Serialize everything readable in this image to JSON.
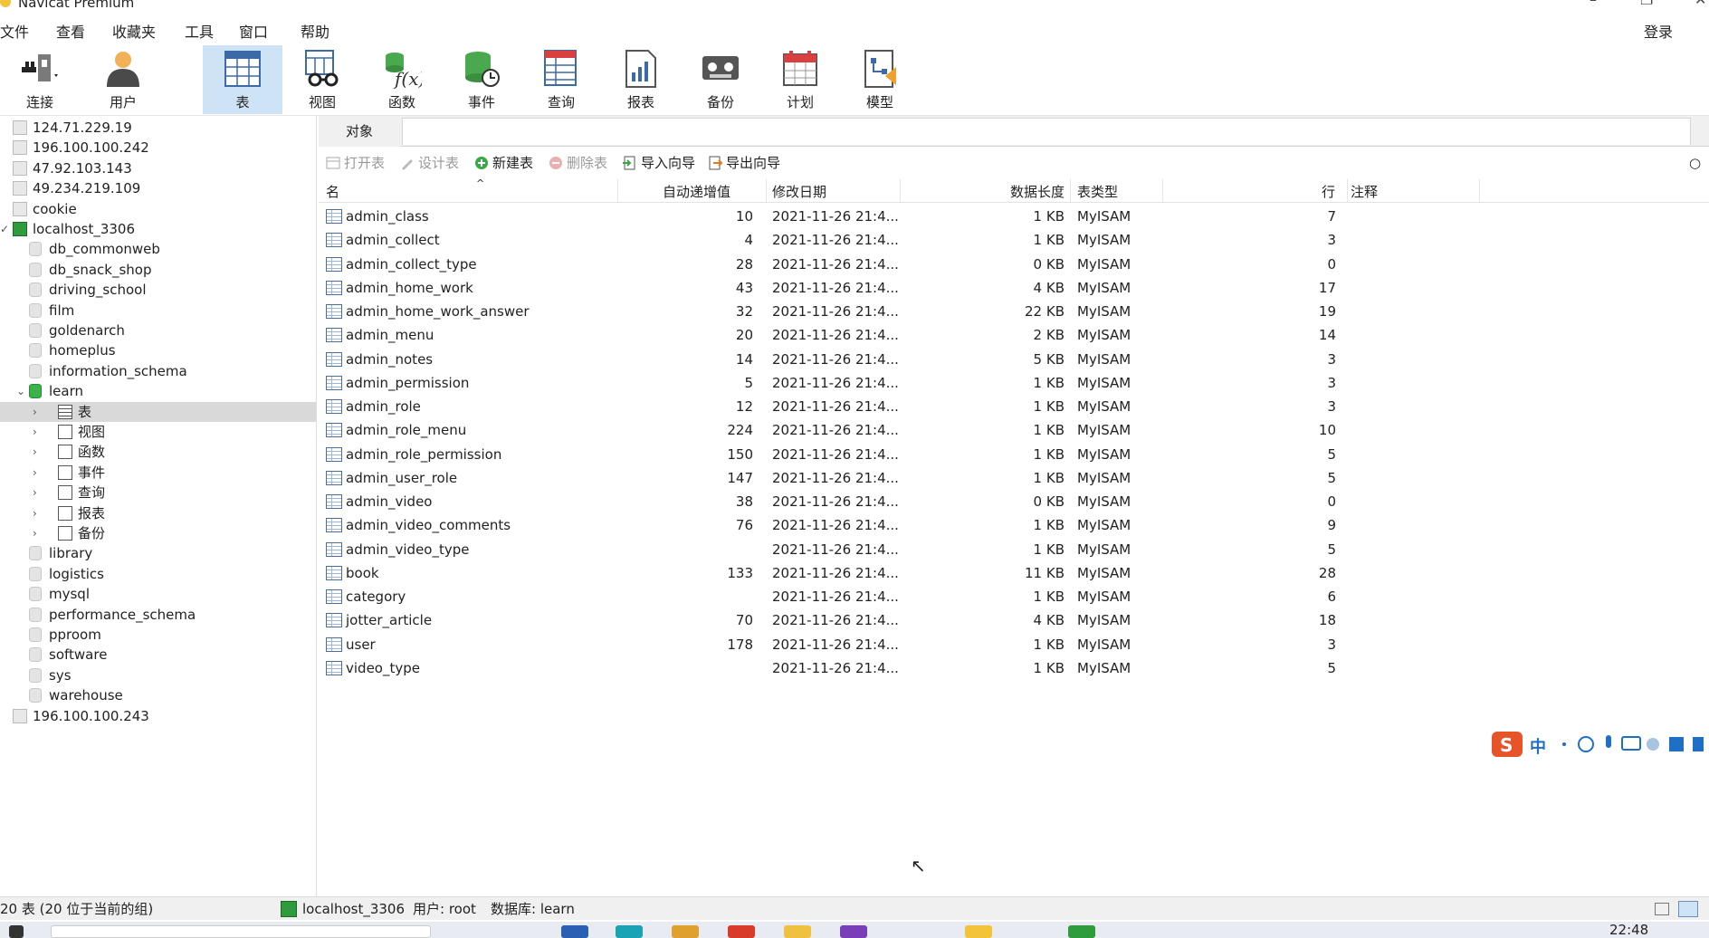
{
  "app": {
    "title": "Navicat Premium"
  },
  "menu": [
    "文件",
    "查看",
    "收藏夹",
    "工具",
    "窗口",
    "帮助"
  ],
  "login_label": "登录",
  "toolbar": [
    {
      "label": "连接",
      "icon": "plug-icon"
    },
    {
      "label": "用户",
      "icon": "user-icon"
    },
    {
      "label": "表",
      "icon": "table-icon",
      "active": true
    },
    {
      "label": "视图",
      "icon": "view-icon"
    },
    {
      "label": "函数",
      "icon": "function-icon"
    },
    {
      "label": "事件",
      "icon": "event-icon"
    },
    {
      "label": "查询",
      "icon": "query-icon"
    },
    {
      "label": "报表",
      "icon": "report-icon"
    },
    {
      "label": "备份",
      "icon": "backup-icon"
    },
    {
      "label": "计划",
      "icon": "schedule-icon"
    },
    {
      "label": "模型",
      "icon": "model-icon"
    }
  ],
  "sidebar": {
    "items": [
      {
        "label": "124.71.229.19",
        "kind": "conn"
      },
      {
        "label": "196.100.100.242",
        "kind": "conn"
      },
      {
        "label": "47.92.103.143",
        "kind": "conn"
      },
      {
        "label": "49.234.219.109",
        "kind": "conn"
      },
      {
        "label": "cookie",
        "kind": "conn"
      },
      {
        "label": "localhost_3306",
        "kind": "conn-open"
      },
      {
        "label": "db_commonweb",
        "kind": "db"
      },
      {
        "label": "db_snack_shop",
        "kind": "db"
      },
      {
        "label": "driving_school",
        "kind": "db"
      },
      {
        "label": "film",
        "kind": "db"
      },
      {
        "label": "goldenarch",
        "kind": "db"
      },
      {
        "label": "homeplus",
        "kind": "db"
      },
      {
        "label": "information_schema",
        "kind": "db"
      },
      {
        "label": "learn",
        "kind": "db-open"
      },
      {
        "label": "表",
        "kind": "node",
        "selected": true
      },
      {
        "label": "视图",
        "kind": "node"
      },
      {
        "label": "函数",
        "kind": "node"
      },
      {
        "label": "事件",
        "kind": "node"
      },
      {
        "label": "查询",
        "kind": "node"
      },
      {
        "label": "报表",
        "kind": "node"
      },
      {
        "label": "备份",
        "kind": "node"
      },
      {
        "label": "library",
        "kind": "db"
      },
      {
        "label": "logistics",
        "kind": "db"
      },
      {
        "label": "mysql",
        "kind": "db"
      },
      {
        "label": "performance_schema",
        "kind": "db"
      },
      {
        "label": "pproom",
        "kind": "db"
      },
      {
        "label": "software",
        "kind": "db"
      },
      {
        "label": "sys",
        "kind": "db"
      },
      {
        "label": "warehouse",
        "kind": "db"
      },
      {
        "label": "196.100.100.243",
        "kind": "conn"
      }
    ]
  },
  "object_tab": {
    "label": "对象"
  },
  "actions": [
    {
      "label": "打开表",
      "enabled": false
    },
    {
      "label": "设计表",
      "enabled": false
    },
    {
      "label": "新建表",
      "enabled": true
    },
    {
      "label": "删除表",
      "enabled": false
    },
    {
      "label": "导入向导",
      "enabled": true
    },
    {
      "label": "导出向导",
      "enabled": true
    }
  ],
  "columns": [
    "名",
    "自动递增值",
    "修改日期",
    "数据长度",
    "表类型",
    "行",
    "注释"
  ],
  "tables": [
    {
      "name": "admin_class",
      "auto_inc": "10",
      "modified": "2021-11-26 21:4...",
      "size": "1 KB",
      "engine": "MyISAM",
      "rows": "7"
    },
    {
      "name": "admin_collect",
      "auto_inc": "4",
      "modified": "2021-11-26 21:4...",
      "size": "1 KB",
      "engine": "MyISAM",
      "rows": "3"
    },
    {
      "name": "admin_collect_type",
      "auto_inc": "28",
      "modified": "2021-11-26 21:4...",
      "size": "0 KB",
      "engine": "MyISAM",
      "rows": "0"
    },
    {
      "name": "admin_home_work",
      "auto_inc": "43",
      "modified": "2021-11-26 21:4...",
      "size": "4 KB",
      "engine": "MyISAM",
      "rows": "17"
    },
    {
      "name": "admin_home_work_answer",
      "auto_inc": "32",
      "modified": "2021-11-26 21:4...",
      "size": "22 KB",
      "engine": "MyISAM",
      "rows": "19"
    },
    {
      "name": "admin_menu",
      "auto_inc": "20",
      "modified": "2021-11-26 21:4...",
      "size": "2 KB",
      "engine": "MyISAM",
      "rows": "14"
    },
    {
      "name": "admin_notes",
      "auto_inc": "14",
      "modified": "2021-11-26 21:4...",
      "size": "5 KB",
      "engine": "MyISAM",
      "rows": "3"
    },
    {
      "name": "admin_permission",
      "auto_inc": "5",
      "modified": "2021-11-26 21:4...",
      "size": "1 KB",
      "engine": "MyISAM",
      "rows": "3"
    },
    {
      "name": "admin_role",
      "auto_inc": "12",
      "modified": "2021-11-26 21:4...",
      "size": "1 KB",
      "engine": "MyISAM",
      "rows": "3"
    },
    {
      "name": "admin_role_menu",
      "auto_inc": "224",
      "modified": "2021-11-26 21:4...",
      "size": "1 KB",
      "engine": "MyISAM",
      "rows": "10"
    },
    {
      "name": "admin_role_permission",
      "auto_inc": "150",
      "modified": "2021-11-26 21:4...",
      "size": "1 KB",
      "engine": "MyISAM",
      "rows": "5"
    },
    {
      "name": "admin_user_role",
      "auto_inc": "147",
      "modified": "2021-11-26 21:4...",
      "size": "1 KB",
      "engine": "MyISAM",
      "rows": "5"
    },
    {
      "name": "admin_video",
      "auto_inc": "38",
      "modified": "2021-11-26 21:4...",
      "size": "0 KB",
      "engine": "MyISAM",
      "rows": "0"
    },
    {
      "name": "admin_video_comments",
      "auto_inc": "76",
      "modified": "2021-11-26 21:4...",
      "size": "1 KB",
      "engine": "MyISAM",
      "rows": "9"
    },
    {
      "name": "admin_video_type",
      "auto_inc": "",
      "modified": "2021-11-26 21:4...",
      "size": "1 KB",
      "engine": "MyISAM",
      "rows": "5"
    },
    {
      "name": "book",
      "auto_inc": "133",
      "modified": "2021-11-26 21:4...",
      "size": "11 KB",
      "engine": "MyISAM",
      "rows": "28"
    },
    {
      "name": "category",
      "auto_inc": "",
      "modified": "2021-11-26 21:4...",
      "size": "1 KB",
      "engine": "MyISAM",
      "rows": "6"
    },
    {
      "name": "jotter_article",
      "auto_inc": "70",
      "modified": "2021-11-26 21:4...",
      "size": "4 KB",
      "engine": "MyISAM",
      "rows": "18"
    },
    {
      "name": "user",
      "auto_inc": "178",
      "modified": "2021-11-26 21:4...",
      "size": "1 KB",
      "engine": "MyISAM",
      "rows": "3"
    },
    {
      "name": "video_type",
      "auto_inc": "",
      "modified": "2021-11-26 21:4...",
      "size": "1 KB",
      "engine": "MyISAM",
      "rows": "5"
    }
  ],
  "ime": {
    "text": "中"
  },
  "status": {
    "count": "20 表 (20 位于当前的组)",
    "connection": "localhost_3306",
    "user": "用户: root",
    "database": "数据库: learn"
  },
  "clock": "22:48"
}
